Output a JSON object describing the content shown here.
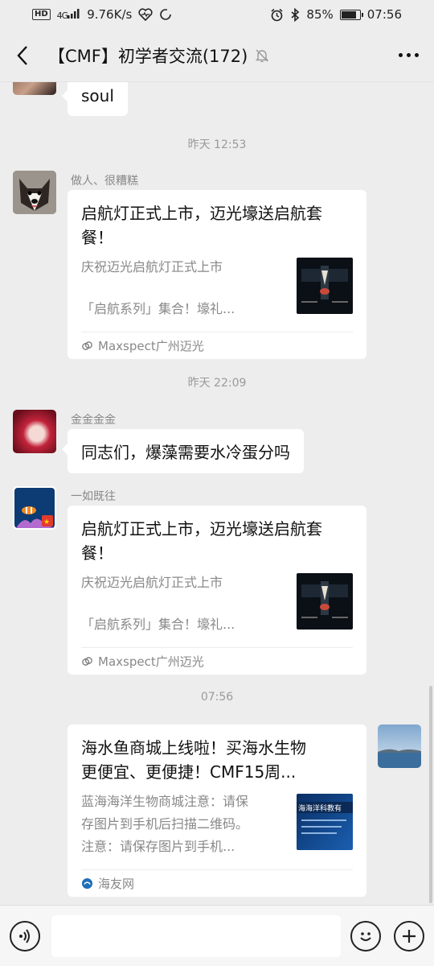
{
  "status_bar": {
    "hd": "HD",
    "network": "4G",
    "speed": "9.76K/s",
    "battery": "85%",
    "battery_level": 0.85,
    "time": "07:56"
  },
  "header": {
    "title": "【CMF】初学者交流(172)"
  },
  "messages": [
    {
      "type": "text",
      "text": "soul"
    },
    {
      "type": "timestamp",
      "text": "昨天 12:53"
    },
    {
      "type": "card",
      "sender": "做人、很糟糕",
      "title": "启航灯正式上市，迈光壕送启航套餐！",
      "desc": "庆祝迈光启航灯正式上市\n\n「启航系列」集合！壕礼...",
      "desc_line1": "庆祝迈光启航灯正式上市",
      "desc_line2": "「启航系列」集合！壕礼...",
      "source": "Maxspect广州迈光"
    },
    {
      "type": "timestamp",
      "text": "昨天 22:09"
    },
    {
      "type": "text",
      "sender": "金金金金",
      "text": "同志们，爆藻需要水冷蛋分吗"
    },
    {
      "type": "card",
      "sender": "一如既往",
      "title": "启航灯正式上市，迈光壕送启航套餐！",
      "desc_line1": "庆祝迈光启航灯正式上市",
      "desc_line2": "「启航系列」集合！壕礼...",
      "source": "Maxspect广州迈光"
    },
    {
      "type": "timestamp",
      "text": "07:56"
    },
    {
      "type": "card",
      "title_line1": "海水鱼商城上线啦！买海水生物",
      "title_line2": "更便宜、更便捷！CMF15周...",
      "desc_line1": "蓝海海洋生物商城注意：请保",
      "desc_line2": "存图片到手机后扫描二维码。",
      "desc_line3": "注意：请保存图片到手机...",
      "thumb_text": "海海洋科教有",
      "source": "海友网"
    }
  ],
  "input": {
    "placeholder": ""
  },
  "colors": {
    "background": "#ededed",
    "bubble": "#ffffff",
    "meta_text": "#888888"
  }
}
